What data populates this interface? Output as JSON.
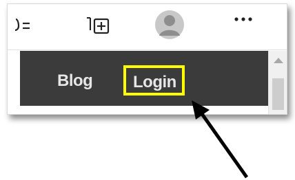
{
  "toolbar": {
    "icons": [
      "reading-list-icon",
      "collections-icon",
      "profile-avatar",
      "more-icon"
    ]
  },
  "nav": {
    "links": [
      {
        "label": "Blog"
      },
      {
        "label": "Login"
      }
    ]
  },
  "highlight": {
    "target": "Login",
    "color": "#ffff00"
  },
  "colors": {
    "nav_bg": "#3b3b3b",
    "nav_text": "#e6e6e6",
    "arrow": "#000000"
  }
}
